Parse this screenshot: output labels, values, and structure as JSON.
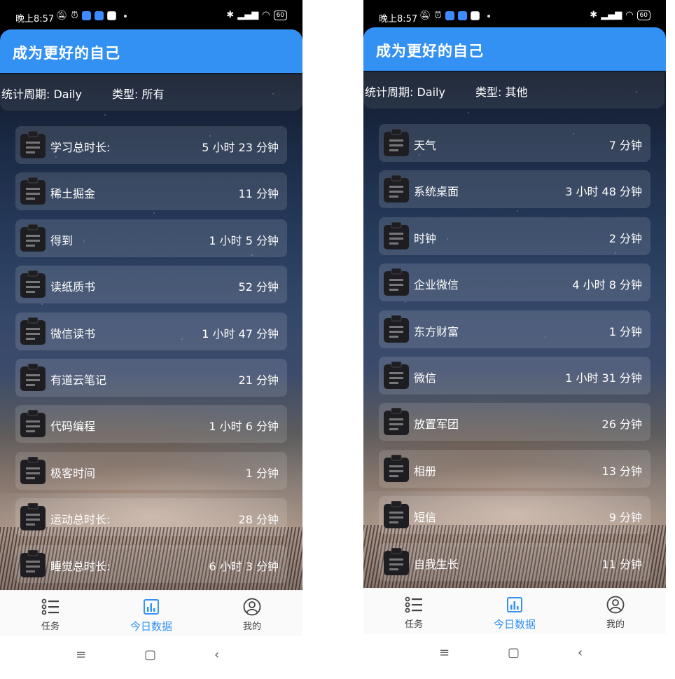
{
  "screens": [
    {
      "status": {
        "time": "晚上8:57",
        "battery": "60"
      },
      "app": {
        "title": "成为更好的自己"
      },
      "filter": {
        "period": "统计周期: Daily",
        "type": "类型: 所有"
      },
      "items": [
        {
          "name": "学习总时长:",
          "duration": "5 小时 23 分钟"
        },
        {
          "name": "稀土掘金",
          "duration": "11 分钟"
        },
        {
          "name": "得到",
          "duration": "1 小时 5 分钟"
        },
        {
          "name": "读纸质书",
          "duration": "52 分钟"
        },
        {
          "name": "微信读书",
          "duration": "1 小时 47 分钟"
        },
        {
          "name": "有道云笔记",
          "duration": "21 分钟"
        },
        {
          "name": "代码编程",
          "duration": "1 小时 6 分钟"
        },
        {
          "name": "极客时间",
          "duration": "1 分钟"
        },
        {
          "name": "运动总时长:",
          "duration": "28 分钟"
        },
        {
          "name": "睡觉总时长:",
          "duration": "6 小时 3 分钟"
        }
      ],
      "tabs": [
        {
          "label": "任务",
          "icon": "list-icon"
        },
        {
          "label": "今日数据",
          "icon": "chart-icon"
        },
        {
          "label": "我的",
          "icon": "profile-icon"
        }
      ]
    },
    {
      "status": {
        "time": "晚上8:57",
        "battery": "60"
      },
      "app": {
        "title": "成为更好的自己"
      },
      "filter": {
        "period": "统计周期: Daily",
        "type": "类型: 其他"
      },
      "items": [
        {
          "name": "天气",
          "duration": "7 分钟"
        },
        {
          "name": "系统桌面",
          "duration": "3 小时 48 分钟"
        },
        {
          "name": "时钟",
          "duration": "2 分钟"
        },
        {
          "name": "企业微信",
          "duration": "4 小时 8 分钟"
        },
        {
          "name": "东方财富",
          "duration": "1 分钟"
        },
        {
          "name": "微信",
          "duration": "1 小时 31 分钟"
        },
        {
          "name": "放置军团",
          "duration": "26 分钟"
        },
        {
          "name": "相册",
          "duration": "13 分钟"
        },
        {
          "name": "短信",
          "duration": "9 分钟"
        },
        {
          "name": "自我生长",
          "duration": "11 分钟"
        }
      ],
      "tabs": [
        {
          "label": "任务",
          "icon": "list-icon"
        },
        {
          "label": "今日数据",
          "icon": "chart-icon"
        },
        {
          "label": "我的",
          "icon": "profile-icon"
        }
      ]
    }
  ],
  "colors": {
    "accent": "#3391f3",
    "tab_active": "#3391f3"
  }
}
